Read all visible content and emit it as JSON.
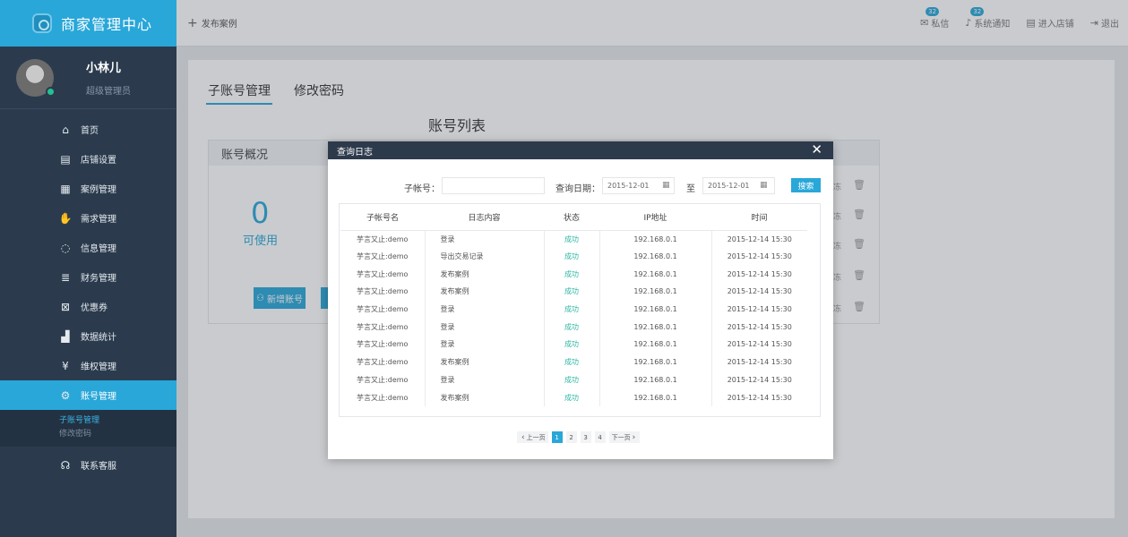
{
  "brand": {
    "title": "商家管理中心"
  },
  "user": {
    "name": "小林儿",
    "role": "超级管理员"
  },
  "sidebar": {
    "items": [
      {
        "label": "首页",
        "icon": "home-icon"
      },
      {
        "label": "店铺设置",
        "icon": "store-icon"
      },
      {
        "label": "案例管理",
        "icon": "grid-icon"
      },
      {
        "label": "需求管理",
        "icon": "hand-icon"
      },
      {
        "label": "信息管理",
        "icon": "chat-icon"
      },
      {
        "label": "财务管理",
        "icon": "coins-icon"
      },
      {
        "label": "优惠券",
        "icon": "coupon-icon"
      },
      {
        "label": "数据统计",
        "icon": "chart-icon"
      },
      {
        "label": "维权管理",
        "icon": "yen-icon"
      },
      {
        "label": "账号管理",
        "icon": "gear-icon"
      },
      {
        "label": "联系客服",
        "icon": "headset-icon"
      }
    ],
    "sub_items": [
      {
        "label": "子账号管理"
      },
      {
        "label": "修改密码"
      }
    ]
  },
  "topbar": {
    "publish_label": "发布案例",
    "links": [
      {
        "label": "私信",
        "badge": "32"
      },
      {
        "label": "系统通知",
        "badge": "32"
      },
      {
        "label": "进入店铺"
      },
      {
        "label": "退出"
      }
    ]
  },
  "main": {
    "tabs": [
      {
        "label": "子账号管理"
      },
      {
        "label": "修改密码"
      }
    ],
    "panel_title": "账号列表",
    "card_title": "账号概况",
    "available_count": "0",
    "available_label": "可使用",
    "add_button_label": "新增账号",
    "row_action_fragment": "冻"
  },
  "modal": {
    "title": "查询日志",
    "filter": {
      "account_label": "子帐号：",
      "account_value": "",
      "date_label": "查询日期：",
      "start_date": "2015-12-01",
      "to_label": "至",
      "end_date": "2015-12-01",
      "search_label": "搜索"
    },
    "columns": [
      "子帐号名",
      "日志内容",
      "状态",
      "IP地址",
      "时间"
    ],
    "rows": [
      [
        "芋言又止:demo",
        "登录",
        "成功",
        "192.168.0.1",
        "2015-12-14 15:30"
      ],
      [
        "芋言又止:demo",
        "导出交易记录",
        "成功",
        "192.168.0.1",
        "2015-12-14 15:30"
      ],
      [
        "芋言又止:demo",
        "发布案例",
        "成功",
        "192.168.0.1",
        "2015-12-14 15:30"
      ],
      [
        "芋言又止:demo",
        "发布案例",
        "成功",
        "192.168.0.1",
        "2015-12-14 15:30"
      ],
      [
        "芋言又止:demo",
        "登录",
        "成功",
        "192.168.0.1",
        "2015-12-14 15:30"
      ],
      [
        "芋言又止:demo",
        "登录",
        "成功",
        "192.168.0.1",
        "2015-12-14 15:30"
      ],
      [
        "芋言又止:demo",
        "登录",
        "成功",
        "192.168.0.1",
        "2015-12-14 15:30"
      ],
      [
        "芋言又止:demo",
        "发布案例",
        "成功",
        "192.168.0.1",
        "2015-12-14 15:30"
      ],
      [
        "芋言又止:demo",
        "登录",
        "成功",
        "192.168.0.1",
        "2015-12-14 15:30"
      ],
      [
        "芋言又止:demo",
        "发布案例",
        "成功",
        "192.168.0.1",
        "2015-12-14 15:30"
      ]
    ],
    "pagination": {
      "prev_label": "上一页",
      "next_label": "下一页",
      "pages": [
        "1",
        "2",
        "3",
        "4"
      ],
      "current": "1"
    }
  },
  "colors": {
    "accent": "#29a7d9",
    "sidebar_bg": "#2b3b4d",
    "modal_header": "#2c3a4b",
    "success": "#2db7a3"
  }
}
